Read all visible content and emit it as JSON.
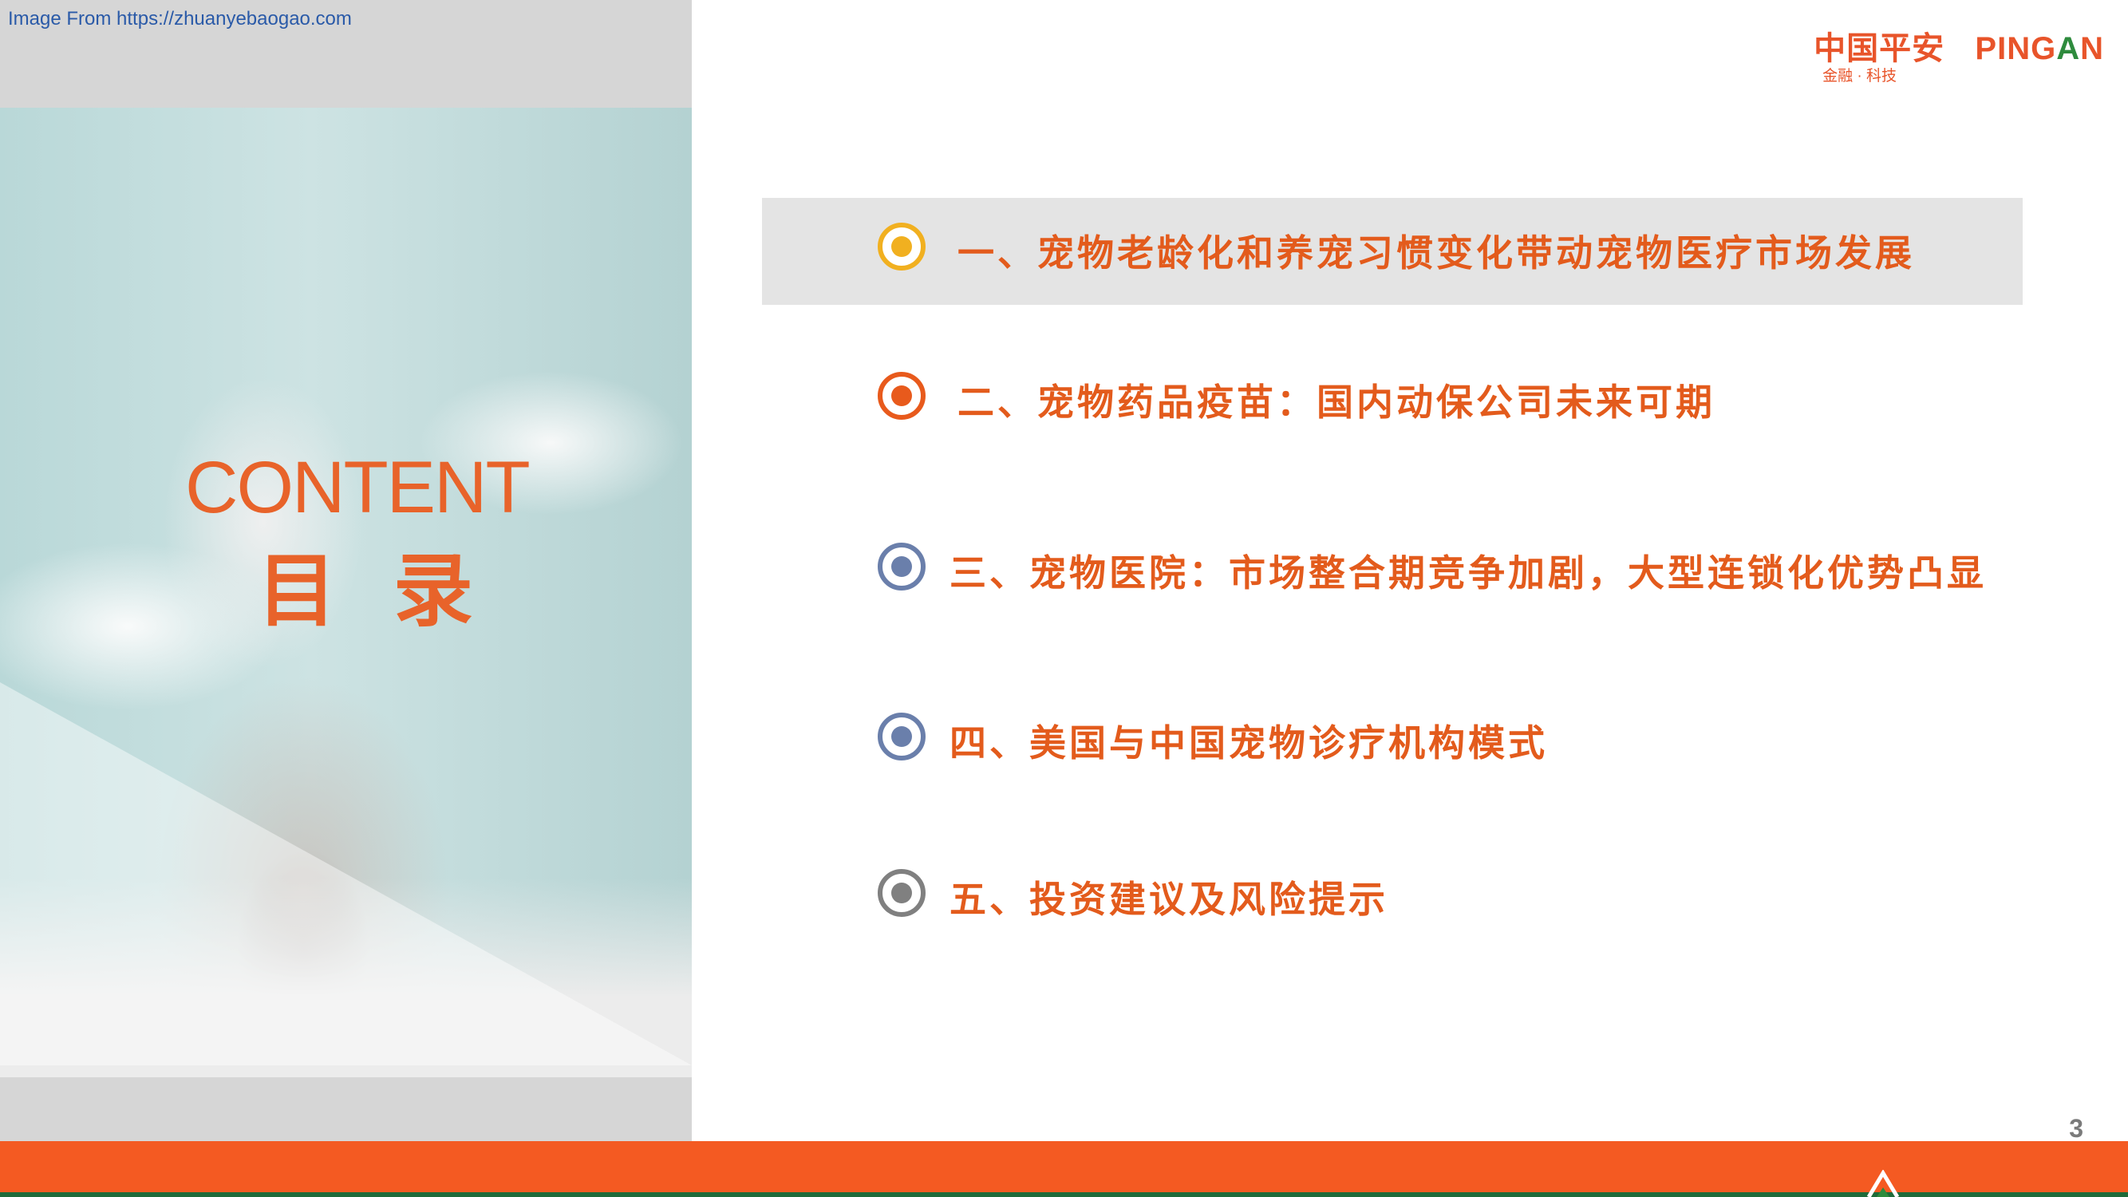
{
  "watermark": "Image From https://zhuanyebaogao.com",
  "logo": {
    "main_cn": "中国平安",
    "main_en_a": "PING",
    "main_en_b": "A",
    "main_en_c": "N",
    "sub": "金融 · 科技"
  },
  "left": {
    "title_en": "CONTENT",
    "title_cn": "目 录"
  },
  "toc": [
    {
      "text": "一、宠物老龄化和养宠习惯变化带动宠物医疗市场发展",
      "marker_color": "#f1b020",
      "highlighted": true
    },
    {
      "text": "二、宠物药品疫苗：国内动保公司未来可期",
      "marker_color": "#e85a1c",
      "highlighted": false
    },
    {
      "text": "三、宠物医院：市场整合期竞争加剧，大型连锁化优势凸显",
      "marker_color": "#6a7fab",
      "highlighted": false
    },
    {
      "text": "四、美国与中国宠物诊疗机构模式",
      "marker_color": "#6a7fab",
      "highlighted": false
    },
    {
      "text": "五、投资建议及风险提示",
      "marker_color": "#808080",
      "highlighted": false
    }
  ],
  "page_number": "3",
  "colors": {
    "accent": "#f45a22",
    "text_orange": "#e35b1c",
    "footer_green": "#1f6b3a"
  }
}
